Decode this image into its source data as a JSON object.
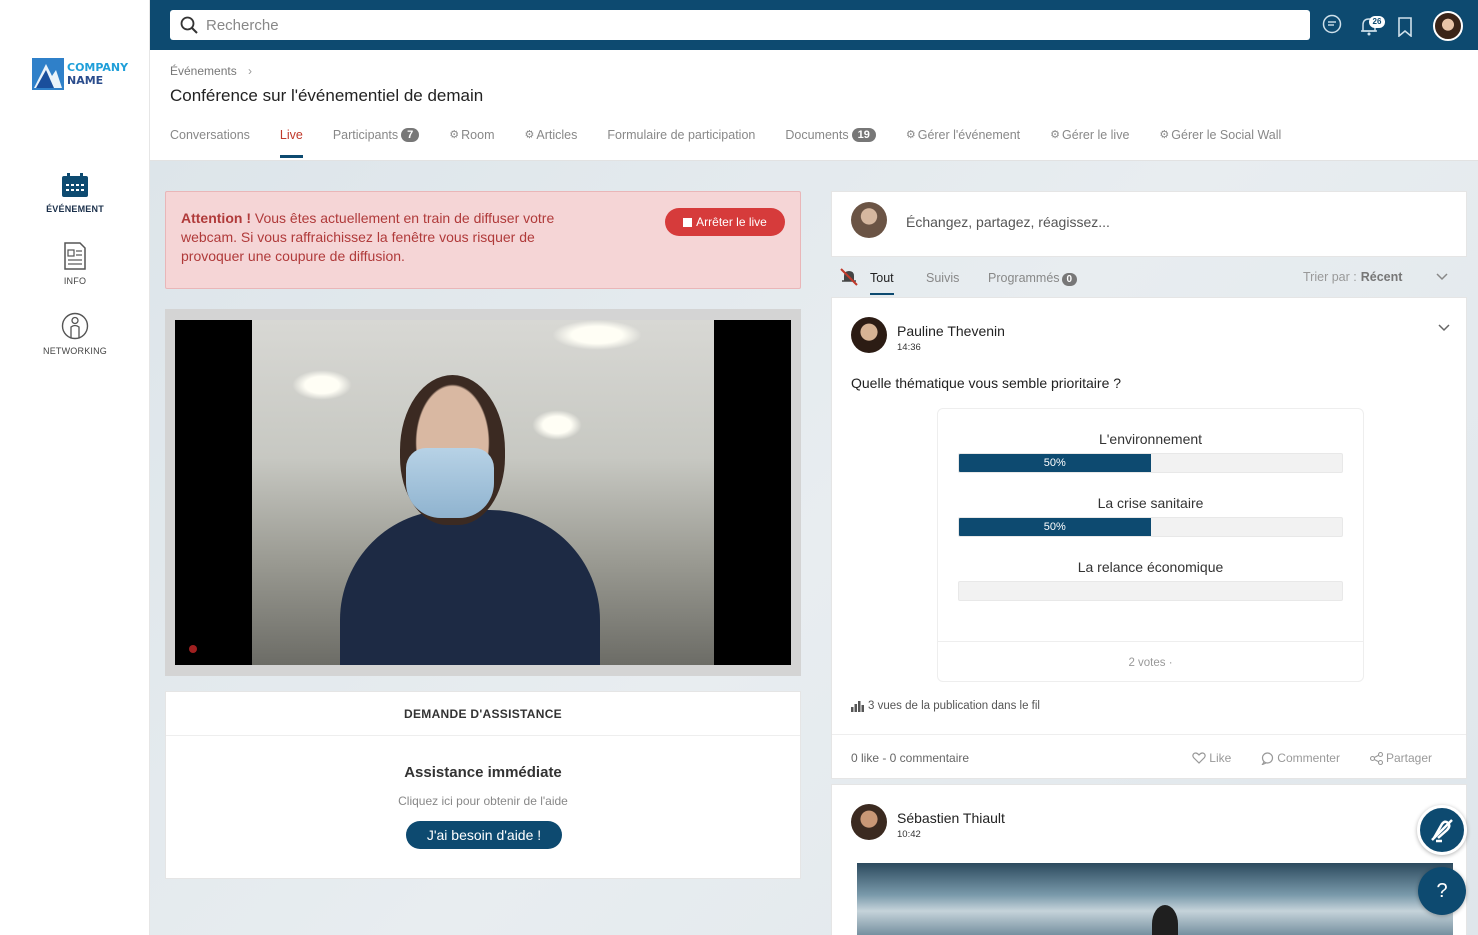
{
  "brand": {
    "line1": "COMPANY",
    "line2": "NAME",
    "primary_color": "#0d4a70",
    "accent_color": "#c0392b"
  },
  "sidebar": {
    "items": [
      {
        "label": "ÉVÉNEMENT",
        "icon": "calendar-icon",
        "active": true
      },
      {
        "label": "INFO",
        "icon": "document-icon",
        "active": false
      },
      {
        "label": "NETWORKING",
        "icon": "person-icon",
        "active": false
      }
    ]
  },
  "topbar": {
    "search_placeholder": "Recherche",
    "notifications_count": "26"
  },
  "header": {
    "breadcrumb": "Événements",
    "title": "Conférence sur l'événementiel de demain",
    "tabs": [
      {
        "label": "Conversations"
      },
      {
        "label": "Live",
        "active": true
      },
      {
        "label": "Participants",
        "badge": "7"
      },
      {
        "label": "Room",
        "gear": true
      },
      {
        "label": "Articles",
        "gear": true
      },
      {
        "label": "Formulaire de participation"
      },
      {
        "label": "Documents",
        "badge": "19"
      },
      {
        "label": "Gérer l'événement",
        "gear": true
      },
      {
        "label": "Gérer le live",
        "gear": true
      },
      {
        "label": "Gérer le Social Wall",
        "gear": true
      }
    ]
  },
  "alert": {
    "strong": "Attention !",
    "text": " Vous êtes actuellement en train de diffuser votre webcam. Si vous raffraichissez la fenêtre vous risquer de provoquer une coupure de diffusion.",
    "stop_label": "Arrêter le live"
  },
  "assistance": {
    "header": "DEMANDE D'ASSISTANCE",
    "title": "Assistance immédiate",
    "subtitle": "Cliquez ici pour obtenir de l'aide",
    "button": "J'ai besoin d'aide !"
  },
  "composer": {
    "placeholder": "Échangez, partagez, réagissez..."
  },
  "feed_tabs": {
    "all": "Tout",
    "followed": "Suivis",
    "scheduled": "Programmés",
    "scheduled_badge": "0",
    "sort_label": "Trier par :",
    "sort_value": "Récent"
  },
  "post1": {
    "author": "Pauline Thevenin",
    "time": "14:36",
    "question": "Quelle thématique vous semble prioritaire ?",
    "poll": {
      "options": [
        {
          "label": "L'environnement",
          "percent": 50,
          "percent_label": "50%"
        },
        {
          "label": "La crise sanitaire",
          "percent": 50,
          "percent_label": "50%"
        },
        {
          "label": "La relance économique",
          "percent": 0,
          "percent_label": ""
        }
      ],
      "votes": "2 votes ·"
    },
    "views": "3 vues de la publication dans le fil",
    "counts": "0 like - 0 commentaire",
    "actions": {
      "like": "Like",
      "comment": "Commenter",
      "share": "Partager"
    }
  },
  "post2": {
    "author": "Sébastien Thiault",
    "time": "10:42"
  },
  "help_fab": "?"
}
